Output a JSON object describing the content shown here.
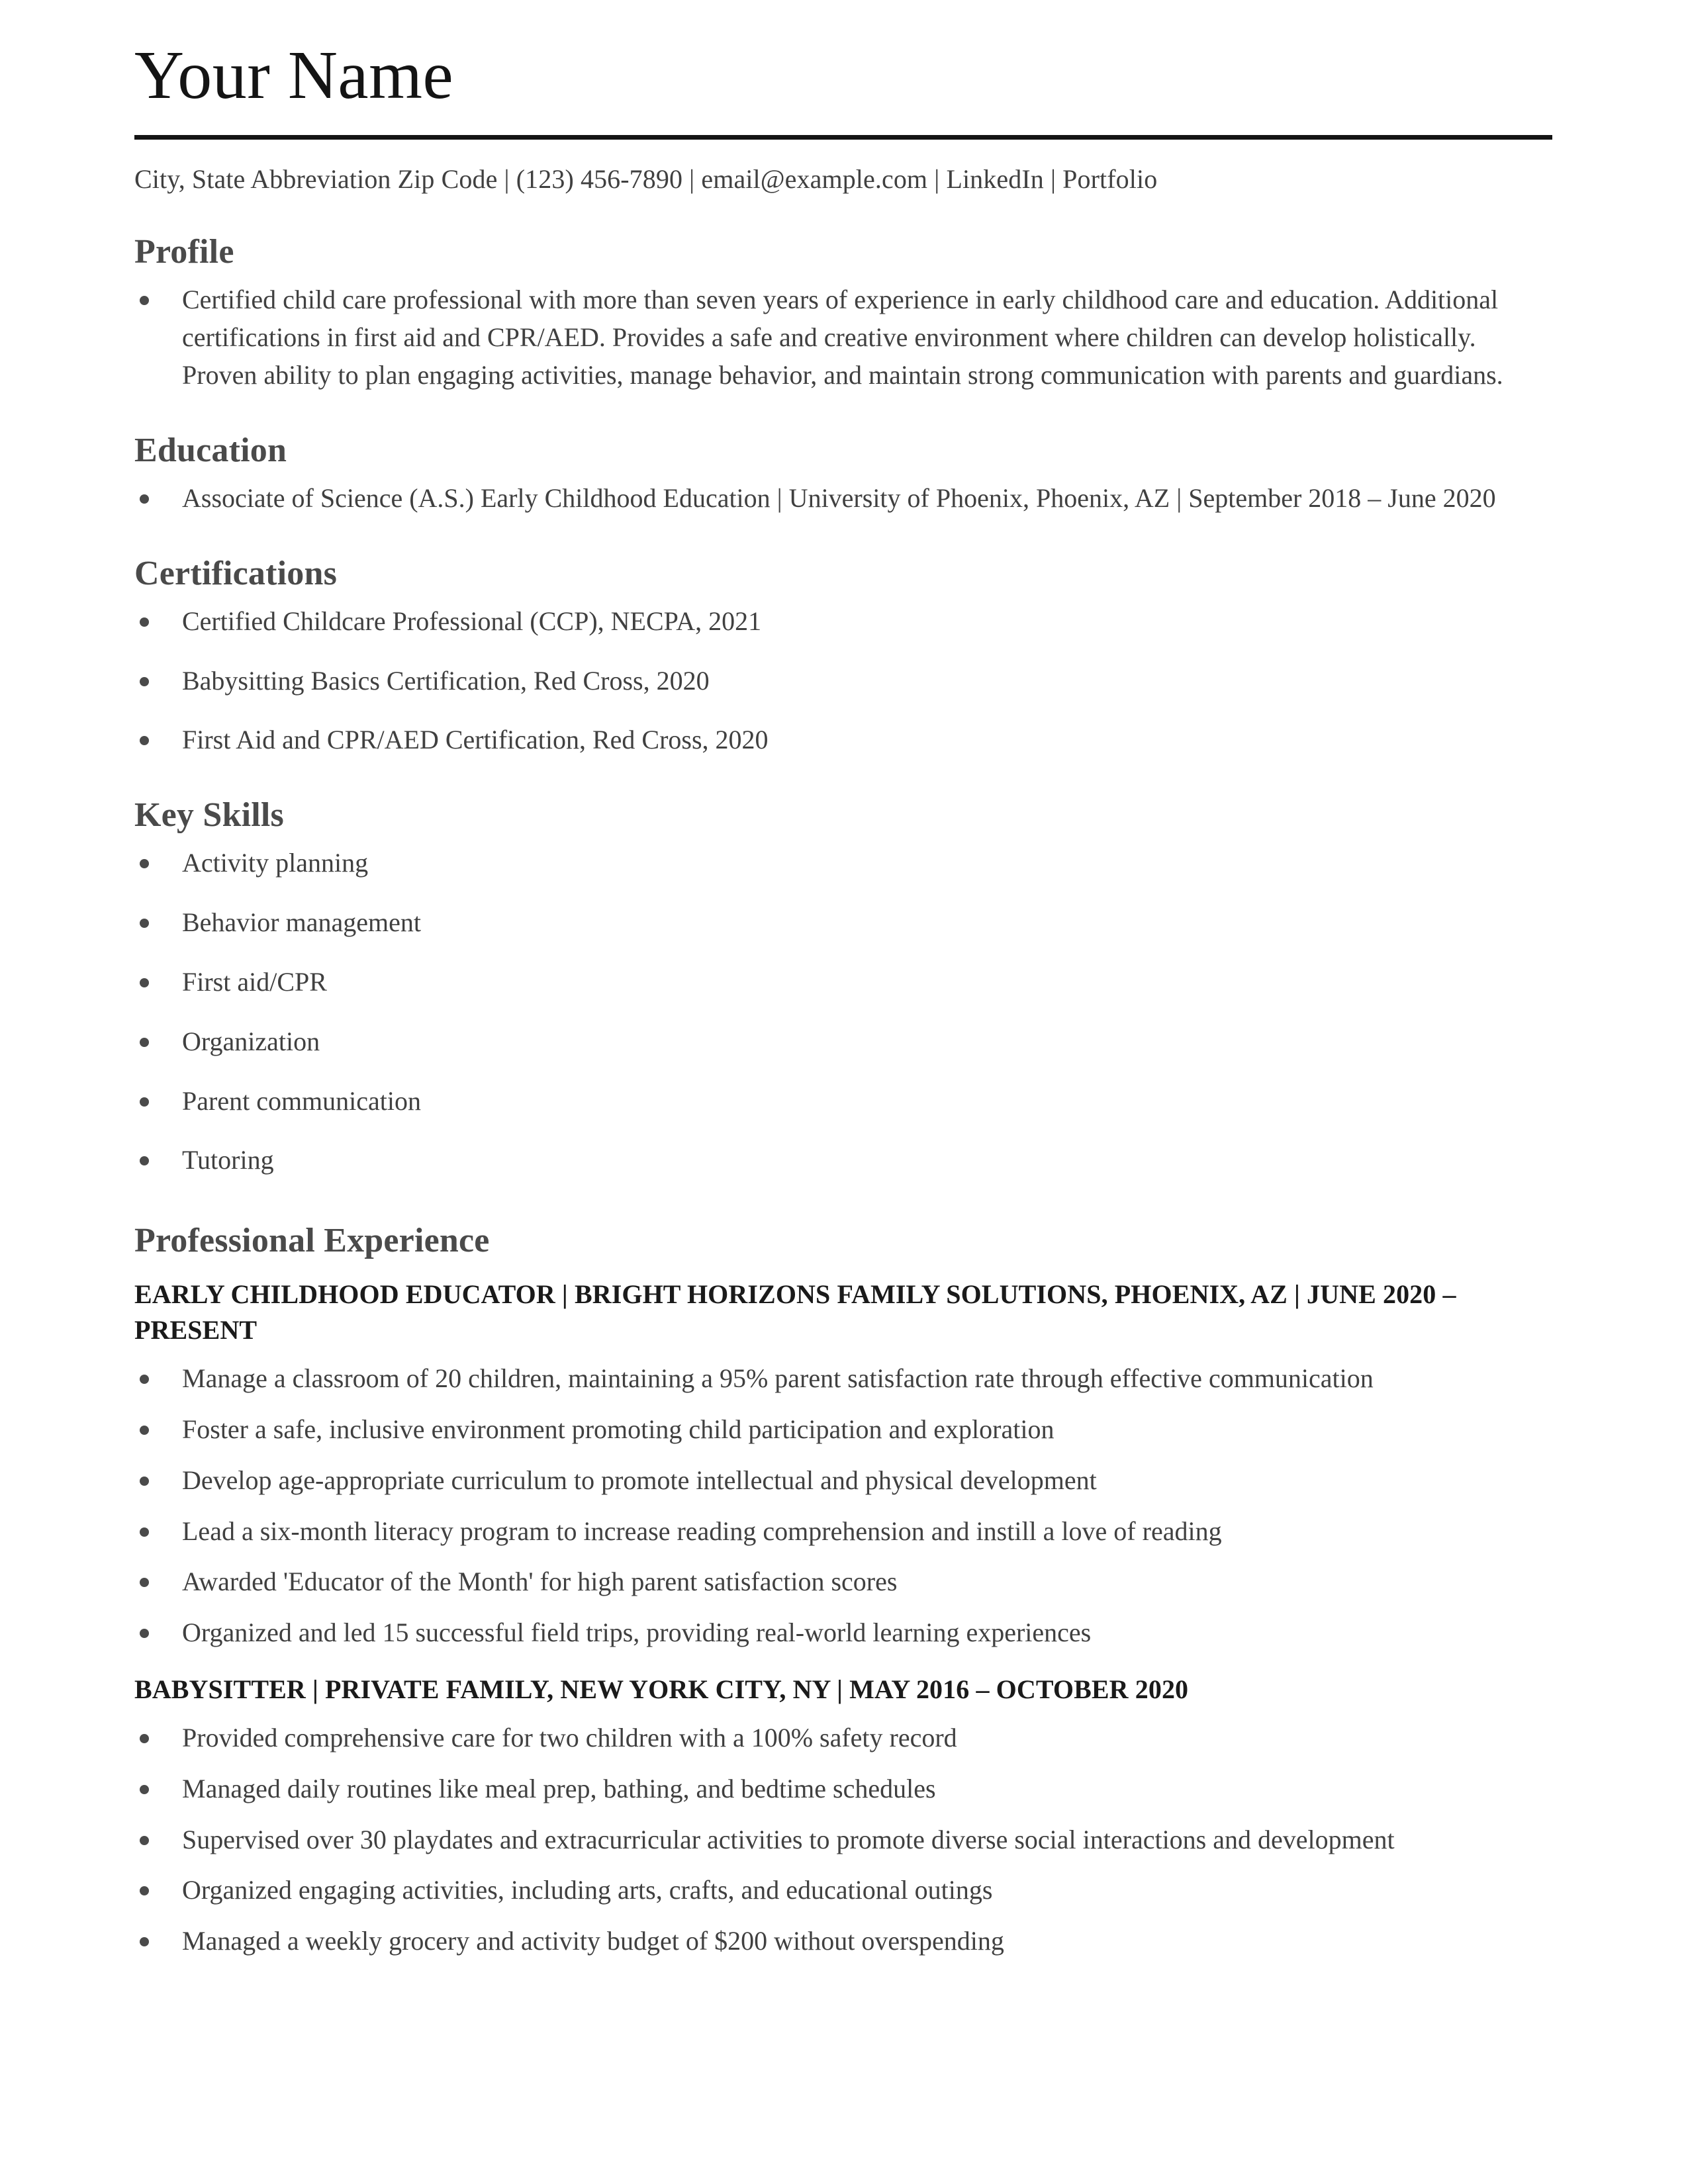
{
  "header": {
    "name": "Your Name",
    "contact": "City, State Abbreviation Zip Code | (123) 456-7890 | email@example.com | LinkedIn | Portfolio"
  },
  "colors": {
    "heading": "#4a4a4a",
    "body": "#404040",
    "name": "#141414",
    "rule": "#141414",
    "job_title": "#1a1a1a",
    "background": "#ffffff"
  },
  "sections": {
    "profile": {
      "title": "Profile",
      "bullets": [
        "Certified child care professional with more than seven years of experience in early childhood care and education. Additional certifications in first aid and CPR/AED. Provides a safe and creative environment where children can develop holistically. Proven ability to plan engaging activities, manage behavior, and maintain strong communication with parents and guardians."
      ]
    },
    "education": {
      "title": "Education",
      "bullets": [
        "Associate of Science (A.S.) Early Childhood Education | University of Phoenix, Phoenix, AZ | September 2018 – June 2020"
      ]
    },
    "certifications": {
      "title": "Certifications",
      "bullets": [
        "Certified Childcare Professional (CCP), NECPA, 2021",
        "Babysitting Basics Certification, Red Cross, 2020",
        "First Aid and CPR/AED Certification, Red Cross, 2020"
      ]
    },
    "key_skills": {
      "title": "Key Skills",
      "bullets": [
        "Activity planning",
        "Behavior management",
        "First aid/CPR",
        "Organization",
        "Parent communication",
        "Tutoring"
      ]
    },
    "experience": {
      "title": "Professional Experience",
      "jobs": [
        {
          "heading": "EARLY CHILDHOOD EDUCATOR | BRIGHT HORIZONS FAMILY SOLUTIONS, PHOENIX, AZ | JUNE 2020 – PRESENT",
          "bullets": [
            "Manage a classroom of 20 children, maintaining a 95% parent satisfaction rate through effective communication",
            "Foster a safe, inclusive environment promoting child participation and exploration",
            "Develop age-appropriate curriculum to promote intellectual and physical development",
            "Lead a six-month literacy program to increase reading comprehension and instill a love of reading",
            "Awarded 'Educator of the Month' for high parent satisfaction scores",
            "Organized and led 15 successful field trips, providing real-world learning experiences"
          ]
        },
        {
          "heading": "BABYSITTER | PRIVATE FAMILY, NEW YORK CITY, NY | MAY 2016 – OCTOBER 2020",
          "bullets": [
            "Provided comprehensive care for two children with a 100% safety record",
            "Managed daily routines like meal prep, bathing, and bedtime schedules",
            "Supervised over 30 playdates and extracurricular activities to promote diverse social interactions and development",
            "Organized engaging activities, including arts, crafts, and educational outings",
            "Managed a weekly grocery and activity budget of $200 without overspending"
          ]
        }
      ]
    }
  }
}
